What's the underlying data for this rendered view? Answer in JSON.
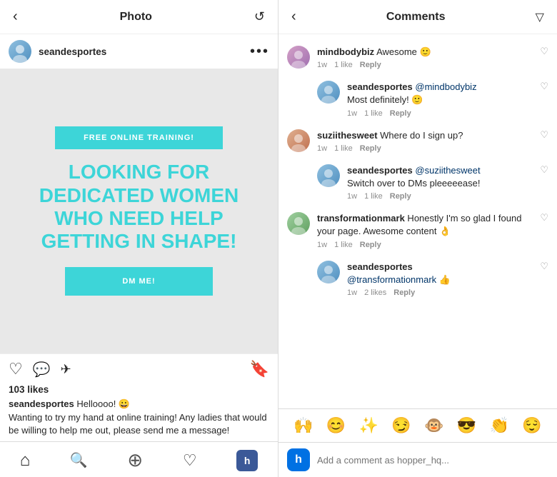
{
  "left": {
    "header": {
      "title": "Photo",
      "back_icon": "‹",
      "refresh_icon": "↺"
    },
    "profile": {
      "username": "seandesportes",
      "more_icon": "•••"
    },
    "post": {
      "free_training_label": "FREE ONLINE TRAINING!",
      "headline": "LOOKING FOR DEDICATED WOMEN WHO NEED HELP GETTING IN SHAPE!",
      "dm_label": "DM ME!"
    },
    "actions": {
      "like_icon": "♡",
      "comment_icon": "💬",
      "share_icon": "✈",
      "bookmark_icon": "🔖"
    },
    "likes": "103 likes",
    "caption": {
      "username": "seandesportes",
      "text": "Helloooo! 😀\nWanting to try my hand at online training! Any ladies that would be willing to help me out, please send me a message!"
    },
    "bottom_nav": {
      "home_icon": "⌂",
      "search_icon": "🔍",
      "add_icon": "⊕",
      "heart_icon": "♡",
      "profile_label": "h"
    }
  },
  "right": {
    "header": {
      "back_icon": "‹",
      "title": "Comments",
      "filter_icon": "▽"
    },
    "comments": [
      {
        "id": "c1",
        "username": "mindbodybiz",
        "text": "Awesome 🙂",
        "time": "1w",
        "likes": "1 like",
        "avatar_class": "av-mindbody"
      },
      {
        "id": "c2",
        "username": "seandesportes",
        "mention": "",
        "text": "@mindbodybiz\nMost definitely! 🙂",
        "time": "1w",
        "likes": "1 like",
        "avatar_class": "av-sean",
        "indent": true
      },
      {
        "id": "c3",
        "username": "suziithesweet",
        "text": "Where do I sign up?",
        "time": "1w",
        "likes": "1 like",
        "avatar_class": "av-suzi"
      },
      {
        "id": "c4",
        "username": "seandesportes",
        "text": "@suziithesweet\nSwitch over to DMs pleeeeease!",
        "time": "1w",
        "likes": "1 like",
        "avatar_class": "av-sean2",
        "indent": true
      },
      {
        "id": "c5",
        "username": "transformationmark",
        "text": "Honestly I'm so glad I found your page. Awesome content 👌",
        "time": "1w",
        "likes": "1 like",
        "avatar_class": "av-transform"
      },
      {
        "id": "c6",
        "username": "seandesportes",
        "text": "@transformationmark 👍",
        "time": "1w",
        "likes": "2 likes",
        "avatar_class": "av-sean",
        "indent": true
      }
    ],
    "emoji_bar": [
      "🙌",
      "😊",
      "✨",
      "😏",
      "🐵",
      "😎",
      "👏",
      "😌"
    ],
    "comment_input": {
      "placeholder": "Add a comment as hopper_hq...",
      "hopper_label": "h"
    }
  }
}
